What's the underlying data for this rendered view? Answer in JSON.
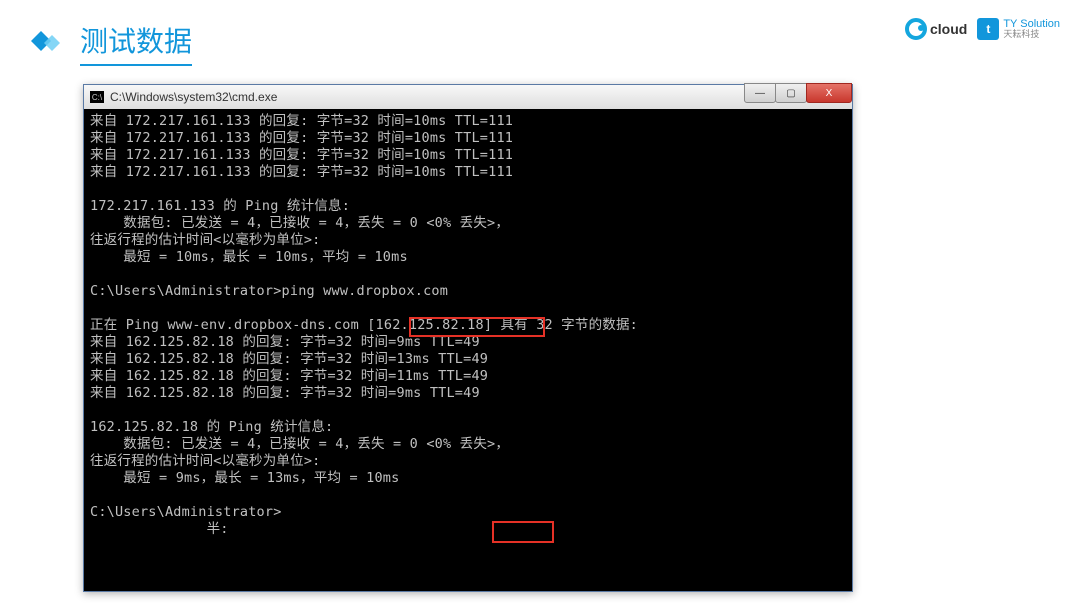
{
  "header": {
    "title": "测试数据",
    "logo1_text": "cloud",
    "logo2_prefix": "t",
    "logo2_main": "TY Solution",
    "logo2_sub": "天耘科技"
  },
  "window": {
    "title_path": "C:\\Windows\\system32\\cmd.exe",
    "icon_glyph": "C:\\",
    "controls": {
      "minimize": "—",
      "maximize": "▢",
      "close": "X"
    }
  },
  "terminal": {
    "lines": [
      "来自 172.217.161.133 的回复: 字节=32 时间=10ms TTL=111",
      "来自 172.217.161.133 的回复: 字节=32 时间=10ms TTL=111",
      "来自 172.217.161.133 的回复: 字节=32 时间=10ms TTL=111",
      "来自 172.217.161.133 的回复: 字节=32 时间=10ms TTL=111",
      "",
      "172.217.161.133 的 Ping 统计信息:",
      "    数据包: 已发送 = 4，已接收 = 4，丢失 = 0 <0% 丢失>，",
      "往返行程的估计时间<以毫秒为单位>:",
      "    最短 = 10ms，最长 = 10ms，平均 = 10ms",
      "",
      "C:\\Users\\Administrator>ping www.dropbox.com",
      "",
      "正在 Ping www-env.dropbox-dns.com [162.125.82.18] 具有 32 字节的数据:",
      "来自 162.125.82.18 的回复: 字节=32 时间=9ms TTL=49",
      "来自 162.125.82.18 的回复: 字节=32 时间=13ms TTL=49",
      "来自 162.125.82.18 的回复: 字节=32 时间=11ms TTL=49",
      "来自 162.125.82.18 的回复: 字节=32 时间=9ms TTL=49",
      "",
      "162.125.82.18 的 Ping 统计信息:",
      "    数据包: 已发送 = 4，已接收 = 4，丢失 = 0 <0% 丢失>，",
      "往返行程的估计时间<以毫秒为单位>:",
      "    最短 = 9ms，最长 = 13ms，平均 = 10ms",
      "",
      "C:\\Users\\Administrator>",
      "              半:"
    ],
    "highlight1_target": "www.dropbox.com",
    "highlight2_target": "10ms"
  }
}
